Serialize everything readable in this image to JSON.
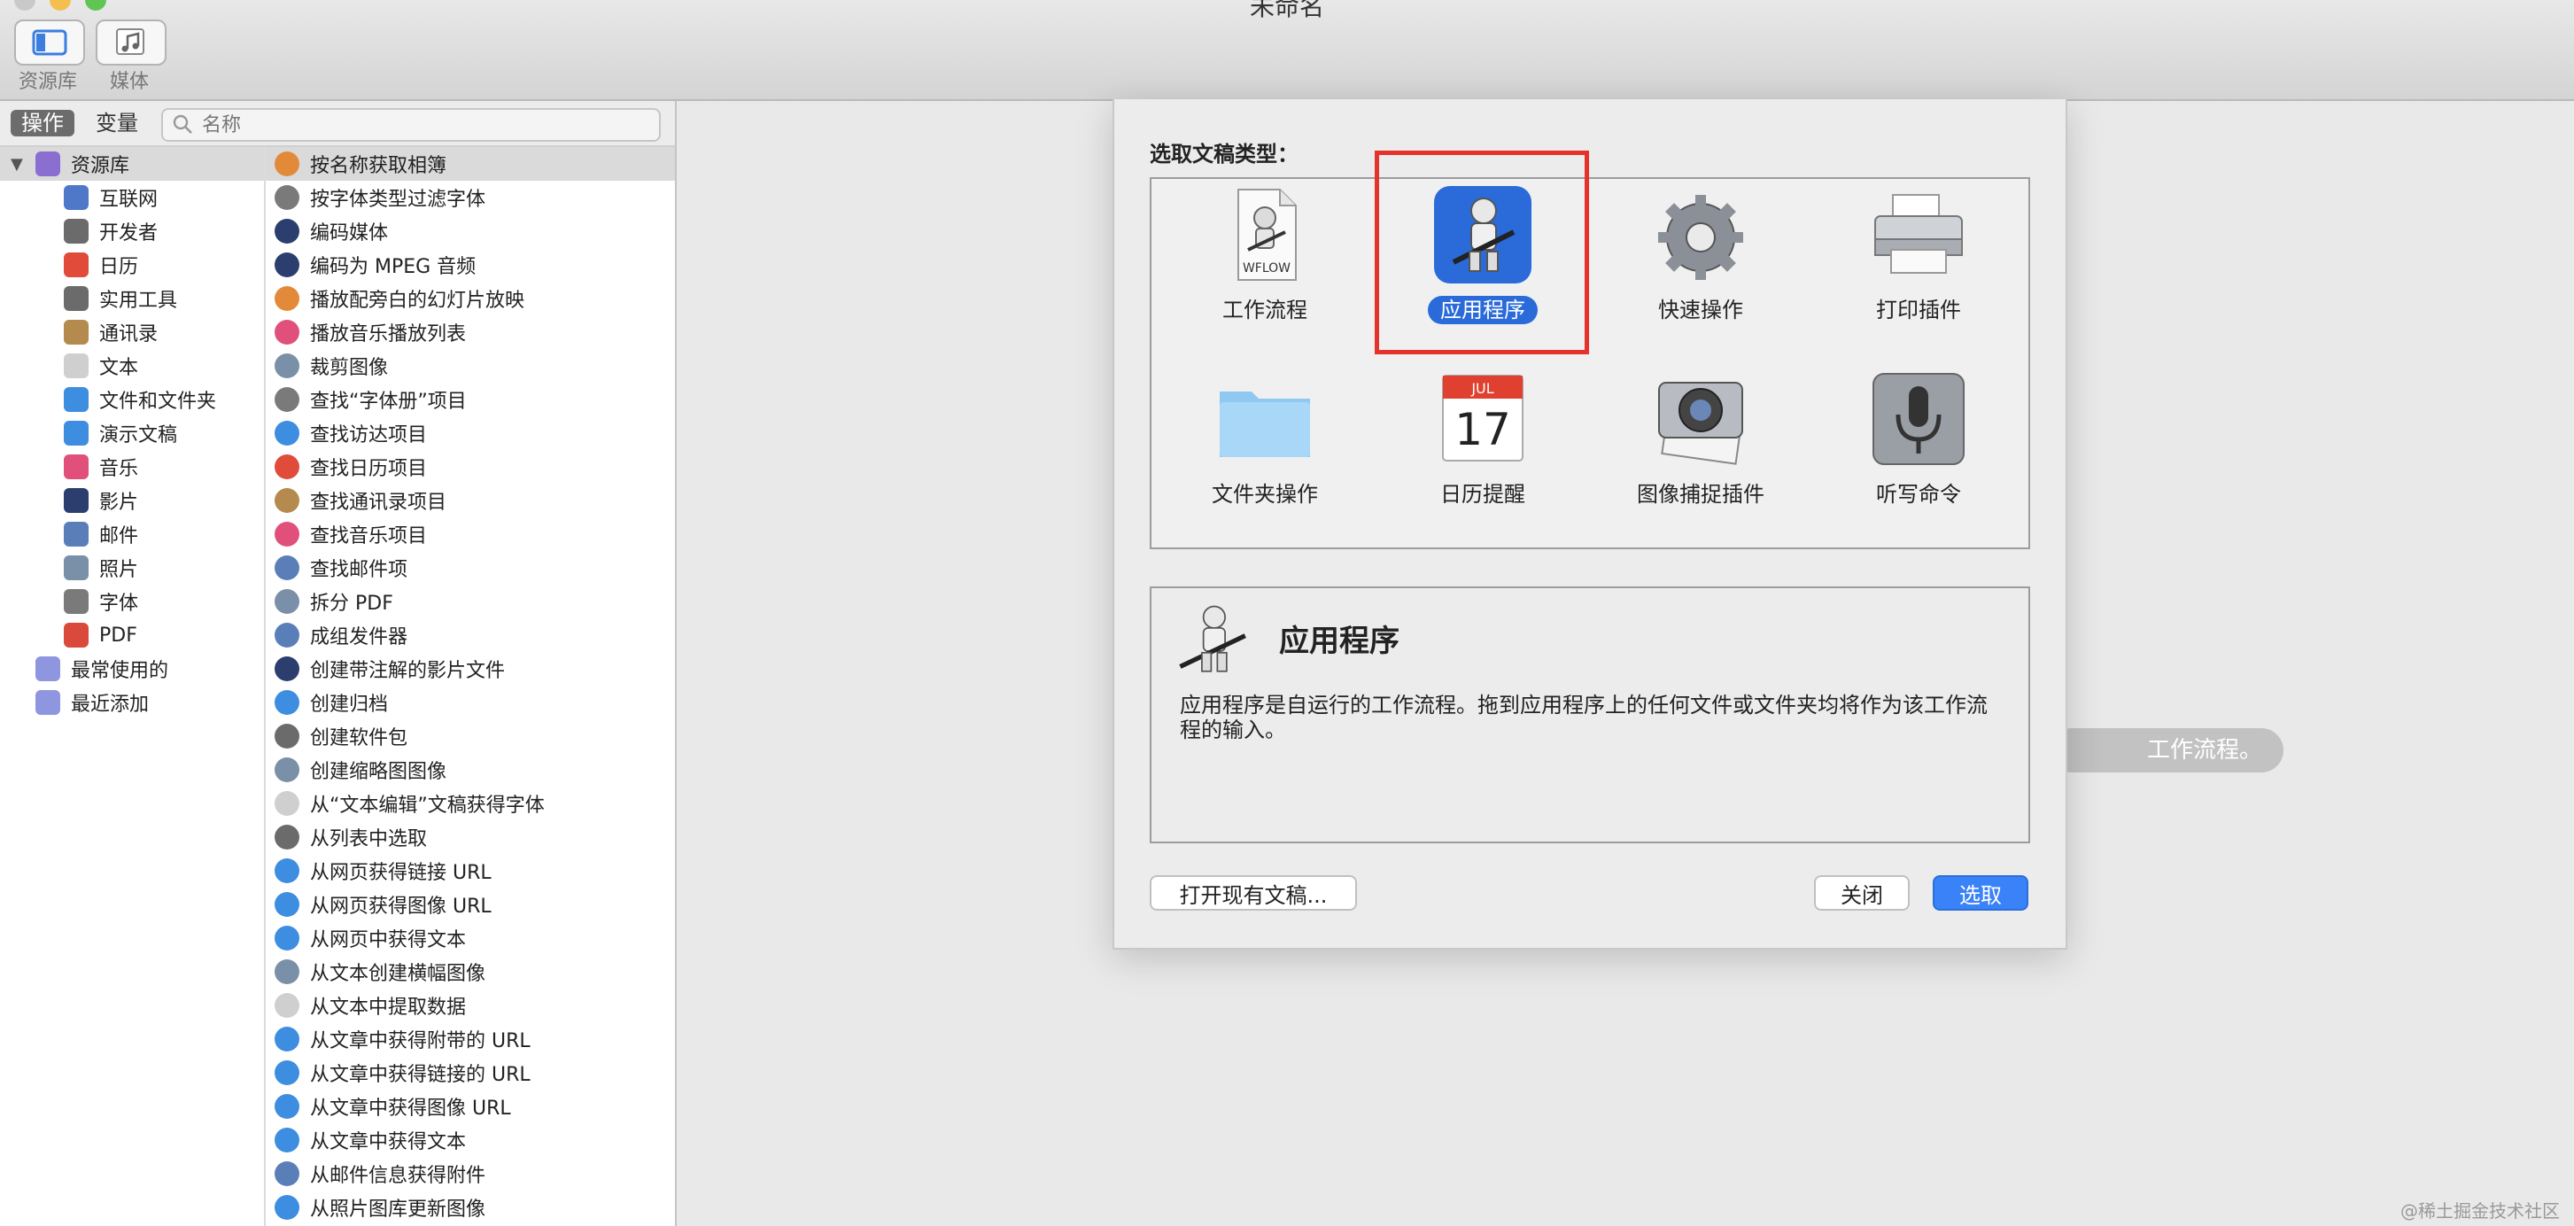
{
  "window": {
    "title": "未命名"
  },
  "toolbar": {
    "library_label": "资源库",
    "media_label": "媒体"
  },
  "left": {
    "tab_actions": "操作",
    "tab_variables": "变量",
    "search_placeholder": "名称",
    "library_items": [
      {
        "label": "资源库",
        "color": "#8a6fd1",
        "level": 0
      },
      {
        "label": "互联网",
        "color": "#4f78c8",
        "level": 1
      },
      {
        "label": "开发者",
        "color": "#6b6b6b",
        "level": 1
      },
      {
        "label": "日历",
        "color": "#e04b3a",
        "level": 1
      },
      {
        "label": "实用工具",
        "color": "#6b6b6b",
        "level": 1
      },
      {
        "label": "通讯录",
        "color": "#b58a4f",
        "level": 1
      },
      {
        "label": "文本",
        "color": "#cfcfcf",
        "level": 1
      },
      {
        "label": "文件和文件夹",
        "color": "#3d8de0",
        "level": 1
      },
      {
        "label": "演示文稿",
        "color": "#3d8de0",
        "level": 1
      },
      {
        "label": "音乐",
        "color": "#e0507a",
        "level": 1
      },
      {
        "label": "影片",
        "color": "#2b3e6e",
        "level": 1
      },
      {
        "label": "邮件",
        "color": "#5a7fb8",
        "level": 1
      },
      {
        "label": "照片",
        "color": "#7a8fa8",
        "level": 1
      },
      {
        "label": "字体",
        "color": "#7a7a7a",
        "level": 1
      },
      {
        "label": "PDF",
        "color": "#d94a3a",
        "level": 1
      },
      {
        "label": "最常使用的",
        "color": "#8f96e0",
        "level": 0
      },
      {
        "label": "最近添加",
        "color": "#8f96e0",
        "level": 0
      }
    ],
    "actions": [
      {
        "label": "按名称获取相簿",
        "color": "#e28a3a"
      },
      {
        "label": "按字体类型过滤字体",
        "color": "#7a7a7a"
      },
      {
        "label": "编码媒体",
        "color": "#2b3e6e"
      },
      {
        "label": "编码为 MPEG 音频",
        "color": "#2b3e6e"
      },
      {
        "label": "播放配旁白的幻灯片放映",
        "color": "#e28a3a"
      },
      {
        "label": "播放音乐播放列表",
        "color": "#e0507a"
      },
      {
        "label": "裁剪图像",
        "color": "#7a8fa8"
      },
      {
        "label": "查找“字体册”项目",
        "color": "#7a7a7a"
      },
      {
        "label": "查找访达项目",
        "color": "#3d8de0"
      },
      {
        "label": "查找日历项目",
        "color": "#e04b3a"
      },
      {
        "label": "查找通讯录项目",
        "color": "#b58a4f"
      },
      {
        "label": "查找音乐项目",
        "color": "#e0507a"
      },
      {
        "label": "查找邮件项",
        "color": "#5a7fb8"
      },
      {
        "label": "拆分 PDF",
        "color": "#7a8fa8"
      },
      {
        "label": "成组发件器",
        "color": "#5a7fb8"
      },
      {
        "label": "创建带注解的影片文件",
        "color": "#2b3e6e"
      },
      {
        "label": "创建归档",
        "color": "#3d8de0"
      },
      {
        "label": "创建软件包",
        "color": "#6b6b6b"
      },
      {
        "label": "创建缩略图图像",
        "color": "#7a8fa8"
      },
      {
        "label": "从“文本编辑”文稿获得字体",
        "color": "#cfcfcf"
      },
      {
        "label": "从列表中选取",
        "color": "#6b6b6b"
      },
      {
        "label": "从网页获得链接 URL",
        "color": "#3d8de0"
      },
      {
        "label": "从网页获得图像 URL",
        "color": "#3d8de0"
      },
      {
        "label": "从网页中获得文本",
        "color": "#3d8de0"
      },
      {
        "label": "从文本创建横幅图像",
        "color": "#7a8fa8"
      },
      {
        "label": "从文本中提取数据",
        "color": "#cfcfcf"
      },
      {
        "label": "从文章中获得附带的 URL",
        "color": "#3d8de0"
      },
      {
        "label": "从文章中获得链接的 URL",
        "color": "#3d8de0"
      },
      {
        "label": "从文章中获得图像 URL",
        "color": "#3d8de0"
      },
      {
        "label": "从文章中获得文本",
        "color": "#3d8de0"
      },
      {
        "label": "从邮件信息获得附件",
        "color": "#5a7fb8"
      },
      {
        "label": "从照片图库更新图像",
        "color": "#3d8de0"
      }
    ]
  },
  "main": {
    "hint_text": "工作流程。"
  },
  "dialog": {
    "heading": "选取文稿类型：",
    "types": [
      {
        "label": "工作流程",
        "icon": "workflow-icon",
        "wflow": "WFLOW"
      },
      {
        "label": "应用程序",
        "icon": "application-icon",
        "selected": true
      },
      {
        "label": "快速操作",
        "icon": "gear-icon"
      },
      {
        "label": "打印插件",
        "icon": "printer-icon"
      },
      {
        "label": "文件夹操作",
        "icon": "folder-icon"
      },
      {
        "label": "日历提醒",
        "icon": "calendar-icon",
        "month": "JUL",
        "day": "17"
      },
      {
        "label": "图像捕捉插件",
        "icon": "camera-icon"
      },
      {
        "label": "听写命令",
        "icon": "microphone-icon"
      }
    ],
    "description": {
      "title": "应用程序",
      "text": "应用程序是自运行的工作流程。拖到应用程序上的任何文件或文件夹均将作为该工作流程的输入。"
    },
    "buttons": {
      "open_existing": "打开现有文稿...",
      "close": "关闭",
      "choose": "选取"
    }
  },
  "watermark": "@稀土掘金技术社区",
  "colors": {
    "accent": "#3a82f7",
    "selection_pill": "#2a6bd9",
    "highlight_red": "#e5322d"
  }
}
